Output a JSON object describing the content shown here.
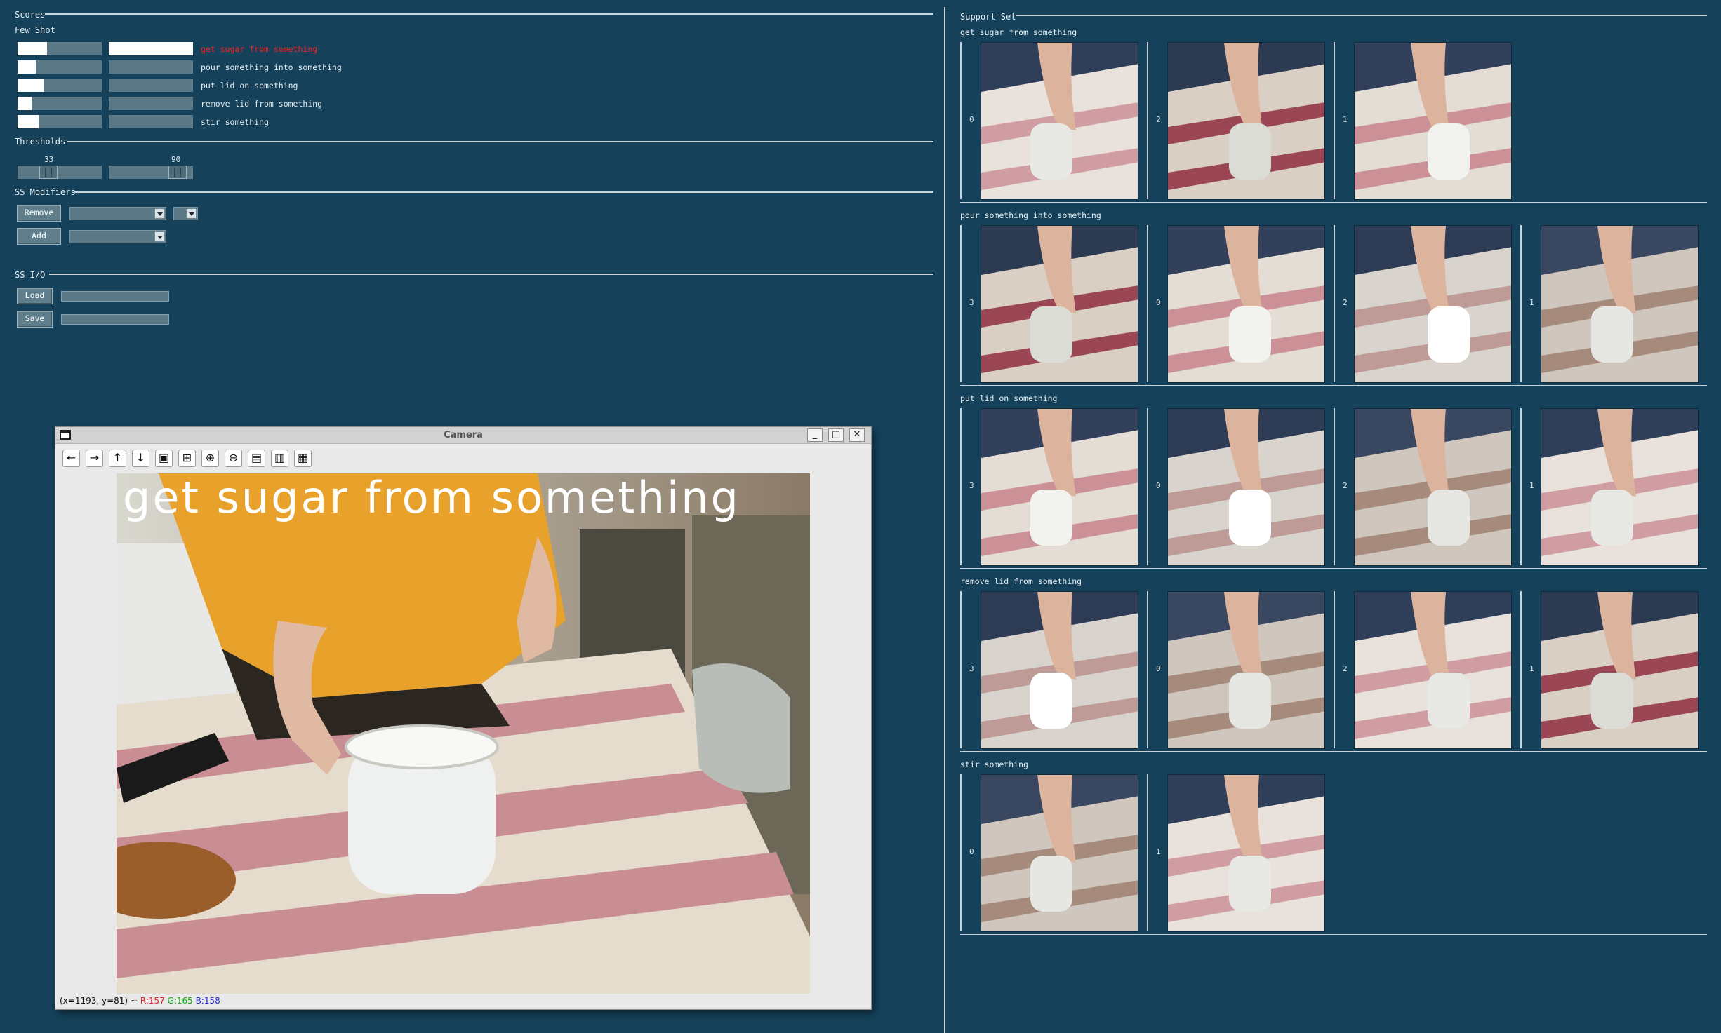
{
  "scores": {
    "title": "Scores",
    "few_shot_label": "Few Shot",
    "items": [
      {
        "label": "get sugar from something",
        "score": 0.35,
        "score2": 1.0,
        "active": true
      },
      {
        "label": "pour something into something",
        "score": 0.22,
        "score2": 0.0,
        "active": false
      },
      {
        "label": "put lid on something",
        "score": 0.31,
        "score2": 0.0,
        "active": false
      },
      {
        "label": "remove lid from something",
        "score": 0.17,
        "score2": 0.0,
        "active": false
      },
      {
        "label": "stir something",
        "score": 0.25,
        "score2": 0.0,
        "active": false
      }
    ]
  },
  "thresholds": {
    "title": "Thresholds",
    "slider1": {
      "value": "33",
      "level": 0.33
    },
    "slider2": {
      "value": "90",
      "level": 0.9
    }
  },
  "ss_modifiers": {
    "title": "SS Modifiers",
    "remove_label": "Remove",
    "add_label": "Add"
  },
  "ss_io": {
    "title": "SS I/O",
    "load_label": "Load",
    "save_label": "Save"
  },
  "camera": {
    "window_title": "Camera",
    "overlay_text": "get sugar from something",
    "status_coords": "(x=1193, y=81) ~",
    "status_r": "R:157",
    "status_g": "G:165",
    "status_b": "B:158",
    "toolbar_icons": [
      "arrow-left-icon",
      "arrow-right-icon",
      "arrow-up-icon",
      "arrow-down-icon",
      "zoom-fit-icon",
      "zoom-original-icon",
      "zoom-in-icon",
      "zoom-out-icon",
      "save-image-icon",
      "copy-clipboard-icon",
      "properties-icon"
    ]
  },
  "support_set": {
    "title": "Support Set",
    "groups": [
      {
        "label": "get sugar from something",
        "indices": [
          "0",
          "2",
          "1"
        ]
      },
      {
        "label": "pour something into something",
        "indices": [
          "3",
          "0",
          "2",
          "1"
        ]
      },
      {
        "label": "put lid on something",
        "indices": [
          "3",
          "0",
          "2",
          "1"
        ]
      },
      {
        "label": "remove lid from something",
        "indices": [
          "3",
          "0",
          "2",
          "1"
        ]
      },
      {
        "label": "stir something",
        "indices": [
          "0",
          "1"
        ]
      }
    ]
  },
  "colors": {
    "background": "#15425a",
    "active_label": "#ff2020",
    "bar_fill": "#ffffff",
    "bar_track": "#5a7886"
  }
}
